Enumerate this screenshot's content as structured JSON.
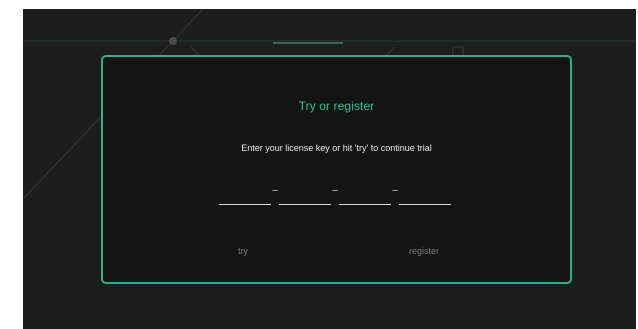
{
  "dialog": {
    "title": "Try or register",
    "message": "Enter your license key or hit 'try' to continue trial",
    "license_fields": [
      {
        "value": "",
        "placeholder": ""
      },
      {
        "value": "",
        "placeholder": ""
      },
      {
        "value": "",
        "placeholder": ""
      },
      {
        "value": "",
        "placeholder": ""
      }
    ],
    "separator": "–",
    "try_label": "try",
    "register_label": "register"
  },
  "colors": {
    "accent": "#22b48f",
    "title": "#22c497",
    "window_bg": "#1d1d1d",
    "dialog_bg": "#141414",
    "button_text": "#7b7b7b"
  }
}
